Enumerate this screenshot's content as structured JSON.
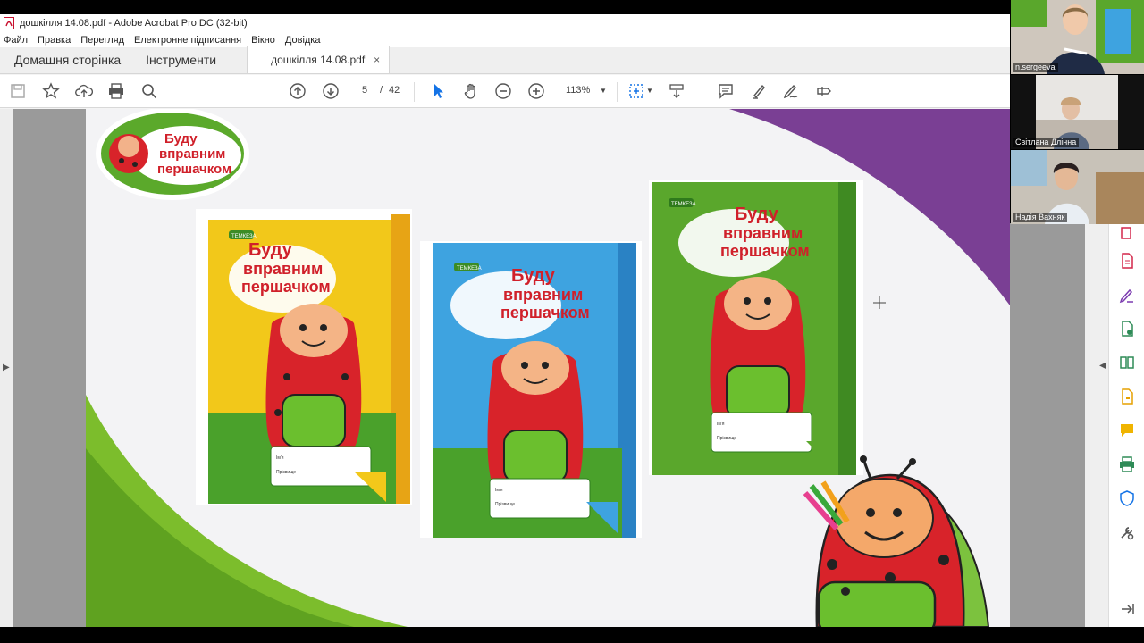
{
  "window": {
    "title": "дошкілля 14.08.pdf - Adobe Acrobat Pro DC (32-bit)"
  },
  "menu": [
    "Файл",
    "Правка",
    "Перегляд",
    "Електронне підписання",
    "Вікно",
    "Довідка"
  ],
  "tabs": {
    "home": "Домашня сторінка",
    "tools": "Інструменти",
    "document": "дошкілля 14.08.pdf",
    "close": "×"
  },
  "toolbar": {
    "page_current": "5",
    "page_sep": "/",
    "page_total": "42",
    "zoom": "113%"
  },
  "slide": {
    "logo_line1": "Буду",
    "logo_line2": "вправним",
    "logo_line3": "першачком",
    "cover_line1": "Буду",
    "cover_line2": "вправним",
    "cover_line3": "першачком",
    "publisher": "ТЕМКЕЗА",
    "label_name": "Ім'я",
    "label_surname": "Прізвище",
    "colors": {
      "yellow": "#f2c81a",
      "blue": "#3ea3e0",
      "green": "#5aa72c",
      "purple": "#7a3f94",
      "lime": "#86c232"
    }
  },
  "participants": [
    {
      "name": "n.sergeeva"
    },
    {
      "name": "Світлана Длінна"
    },
    {
      "name": "Надія Вахняк"
    }
  ],
  "icons": [
    "save-icon",
    "star-icon",
    "upload-icon",
    "print-icon",
    "search-icon",
    "prev-page-icon",
    "next-page-icon",
    "select-cursor-icon",
    "hand-icon",
    "zoom-out-icon",
    "zoom-in-icon",
    "fit-page-icon",
    "scroll-icon",
    "comment-icon",
    "highlight-icon",
    "sign-icon",
    "edit-icon"
  ]
}
